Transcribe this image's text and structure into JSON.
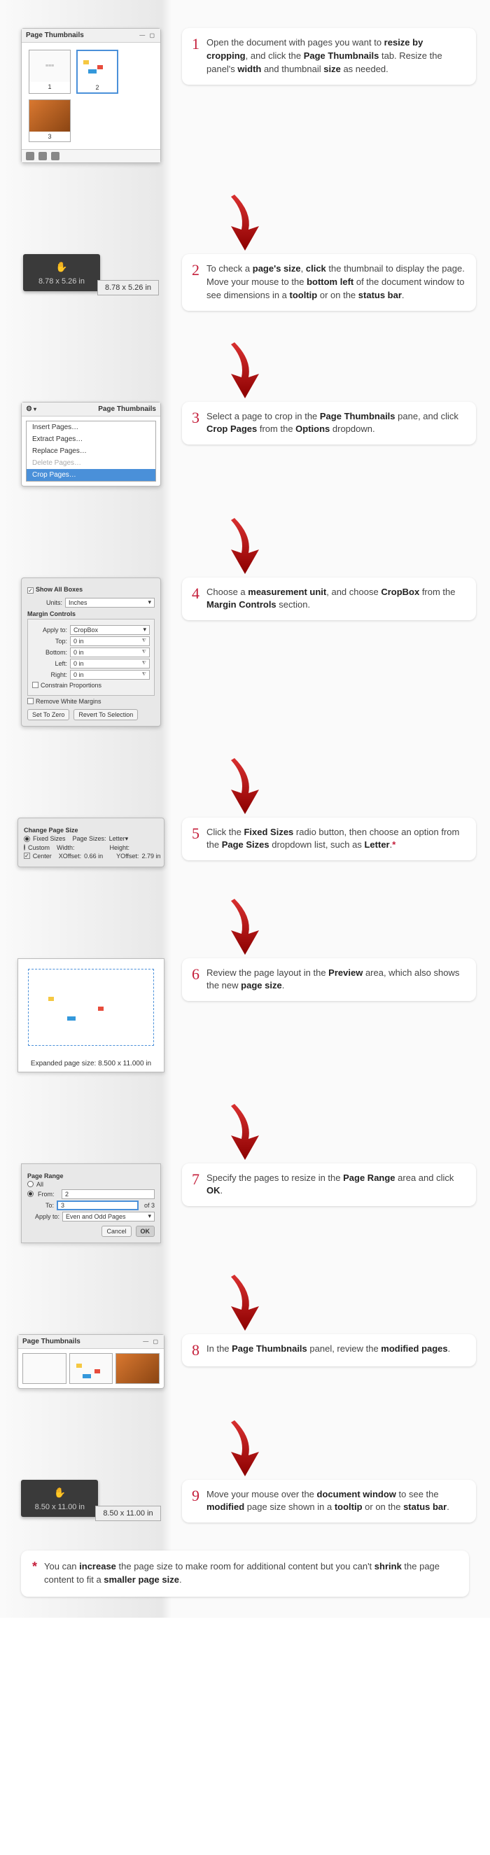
{
  "steps": {
    "s1": {
      "num": "1",
      "text_parts": [
        "Open the document with pages you want to ",
        "resize by cropping",
        ", and click the ",
        "Page Thumbnails",
        " tab. Resize the panel's ",
        "width",
        " and thumbnail ",
        "size",
        " as needed."
      ]
    },
    "s2": {
      "num": "2",
      "text_parts": [
        "To check a ",
        "page's size",
        ", ",
        "click",
        " the thumbnail to display the page. Move your mouse to the ",
        "bottom left",
        " of the document window to see dimensions in a ",
        "tooltip",
        " or on the ",
        "status bar",
        "."
      ]
    },
    "s3": {
      "num": "3",
      "text_parts": [
        "Select a page to crop in the ",
        "Page Thumbnails",
        " pane, and click ",
        "Crop Pages",
        " from the ",
        "Options",
        " dropdown."
      ]
    },
    "s4": {
      "num": "4",
      "text_parts": [
        "Choose a ",
        "measurement unit",
        ", and choose ",
        "CropBox",
        " from the ",
        "Margin Controls",
        " section."
      ]
    },
    "s5": {
      "num": "5",
      "text_parts": [
        "Click the ",
        "Fixed Sizes",
        " radio button, then choose an option from the ",
        "Page Sizes",
        " dropdown list, such as ",
        "Letter",
        "."
      ]
    },
    "s6": {
      "num": "6",
      "text_parts": [
        " Review the page layout in the ",
        "Preview",
        " area, which also shows the new ",
        "page size",
        "."
      ]
    },
    "s7": {
      "num": "7",
      "text_parts": [
        "Specify the pages to resize in the ",
        "Page Range",
        " area and click ",
        "OK",
        "."
      ]
    },
    "s8": {
      "num": "8",
      "text_parts": [
        "In the ",
        "Page Thumbnails",
        " panel, review the ",
        "modified pages",
        "."
      ]
    },
    "s9": {
      "num": "9",
      "text_parts": [
        "Move your mouse over the ",
        "document window",
        " to see the ",
        "modified",
        " page size shown in a ",
        "tooltip",
        " or on the ",
        "status bar",
        "."
      ]
    }
  },
  "panels": {
    "thumbnails_title": "Page Thumbnails",
    "thumb_labels": {
      "p1": "1",
      "p2": "2",
      "p3": "3"
    }
  },
  "dim": {
    "before": "8.78 x 5.26 in",
    "before_tip": "8.78 x 5.26 in",
    "after": "8.50 x 11.00 in",
    "after_tip": "8.50 x 11.00 in"
  },
  "ctx": {
    "insert": "Insert Pages…",
    "extract": "Extract Pages…",
    "replace": "Replace Pages…",
    "delete": "Delete Pages…",
    "crop": "Crop Pages…"
  },
  "d4": {
    "show_all": "Show All Boxes",
    "units_label": "Units:",
    "units_value": "Inches",
    "margin_controls": "Margin Controls",
    "apply_to": "Apply to:",
    "apply_value": "CropBox",
    "top": "Top:",
    "bottom": "Bottom:",
    "left": "Left:",
    "right": "Right:",
    "zero": "0 in",
    "constrain": "Constrain Proportions",
    "remove_white": "Remove White Margins",
    "set_zero": "Set To Zero",
    "revert": "Revert To Selection"
  },
  "d5": {
    "title": "Change Page Size",
    "fixed_sizes": "Fixed Sizes",
    "page_sizes_label": "Page Sizes:",
    "page_sizes_value": "Letter",
    "custom": "Custom",
    "width_label": "Width:",
    "height_label": "Height:",
    "center": "Center",
    "xoffset_label": "XOffset:",
    "xoffset_value": "0.66 in",
    "yoffset_label": "YOffset:",
    "yoffset_value": "2.79 in"
  },
  "d6": {
    "caption": "Expanded page size: 8.500 x 11.000 in"
  },
  "d7": {
    "title": "Page Range",
    "all": "All",
    "from": "From:",
    "from_val": "2",
    "to": "To:",
    "to_val": "3",
    "of": "of 3",
    "apply_to": "Apply to:",
    "apply_val": "Even and Odd Pages",
    "cancel": "Cancel",
    "ok": "OK"
  },
  "footnote": {
    "mark": "*",
    "text_parts": [
      "You can ",
      "increase",
      " the page size to make room for additional content but you can't ",
      "shrink",
      " the page content to fit a ",
      "smaller page size",
      "."
    ]
  }
}
